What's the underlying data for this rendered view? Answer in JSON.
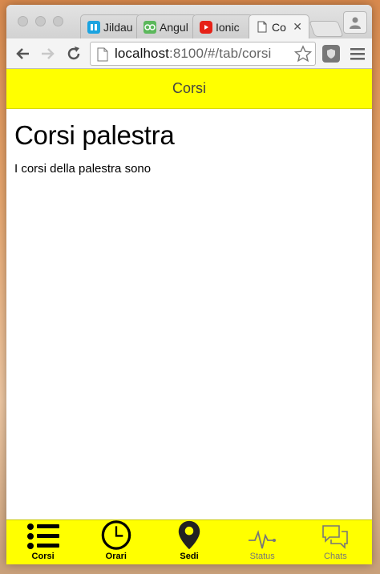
{
  "browser": {
    "tabs": [
      {
        "label": "Jildau",
        "favicon_color": "#1aa3e0"
      },
      {
        "label": "Angul",
        "favicon_color": "#5cb85c"
      },
      {
        "label": "Ionic",
        "favicon_color": "#e62117"
      },
      {
        "label": "Co",
        "favicon_color": "#ffffff"
      }
    ],
    "close_glyph": "✕",
    "url_host": "localhost",
    "url_path": ":8100/#/tab/corsi"
  },
  "app": {
    "header_title": "Corsi",
    "page_title": "Corsi palestra",
    "body_text": "I corsi della palestra sono",
    "accent_color": "#ffff00",
    "tabs": [
      {
        "label": "Corsi",
        "icon": "list-icon",
        "active": true
      },
      {
        "label": "Orari",
        "icon": "clock-icon",
        "active": true
      },
      {
        "label": "Sedi",
        "icon": "map-pin-icon",
        "active": true
      },
      {
        "label": "Status",
        "icon": "pulse-icon",
        "active": false
      },
      {
        "label": "Chats",
        "icon": "chat-bubbles-icon",
        "active": false
      }
    ]
  }
}
